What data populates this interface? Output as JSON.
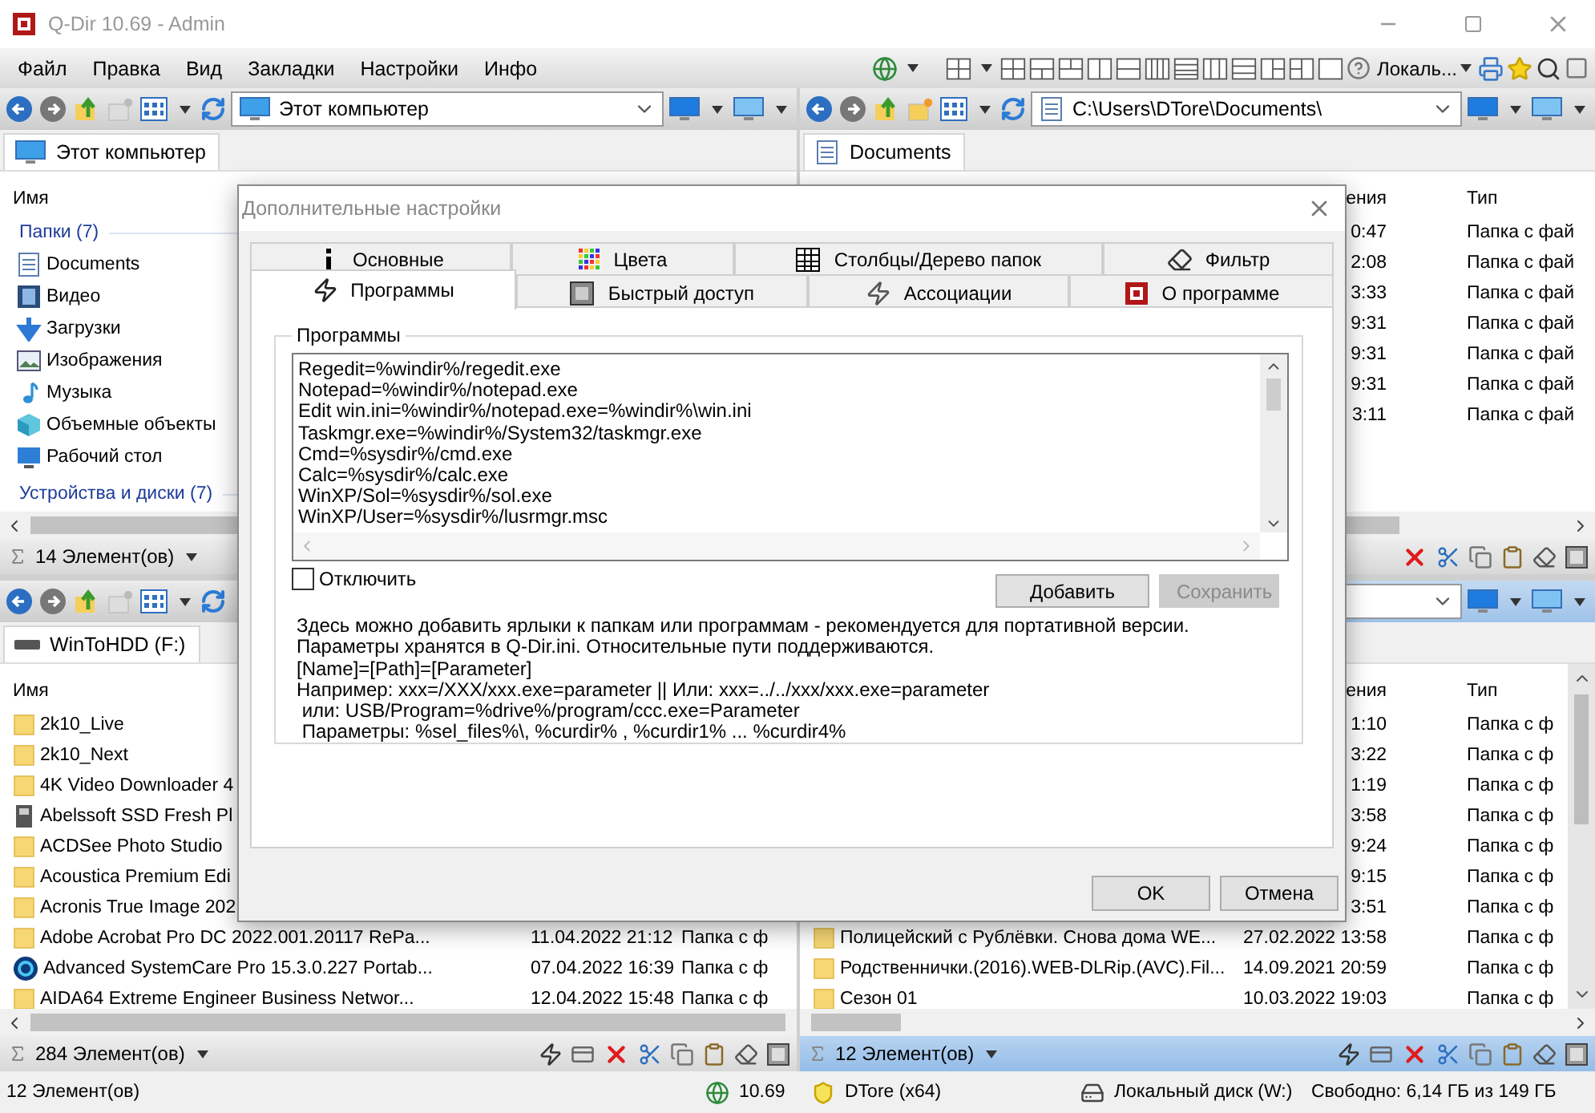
{
  "window": {
    "title": "Q-Dir 10.69 - Admin"
  },
  "menu": [
    "Файл",
    "Правка",
    "Вид",
    "Закладки",
    "Настройки",
    "Инфо"
  ],
  "toolbar": {
    "language": "Локаль..."
  },
  "panes": [
    {
      "active": false,
      "address": "Этот компьютер",
      "tab": "Этот компьютер",
      "columns": [
        {
          "kind": "name",
          "label": "Имя"
        }
      ],
      "groups": [
        {
          "label": "Папки (7)",
          "items": [
            "Documents",
            "Видео",
            "Загрузки",
            "Изображения",
            "Музыка",
            "Объемные объекты",
            "Рабочий стол"
          ]
        },
        {
          "label": "Устройства и диски (7)"
        }
      ],
      "count": "14 Элемент(ов)"
    },
    {
      "active": false,
      "address": "C:\\Users\\DTore\\Documents\\",
      "tab": "Documents",
      "columns": [
        {
          "kind": "date",
          "label": "ения"
        },
        {
          "kind": "type",
          "label": "Тип"
        }
      ],
      "rows": [
        {
          "date": "0:47",
          "type": "Папка с фай"
        },
        {
          "date": "2:08",
          "type": "Папка с фай"
        },
        {
          "date": "3:33",
          "type": "Папка с фай"
        },
        {
          "date": "9:31",
          "type": "Папка с фай"
        },
        {
          "date": "9:31",
          "type": "Папка с фай"
        },
        {
          "date": "9:31",
          "type": "Папка с фай"
        },
        {
          "date": "3:11",
          "type": "Папка с фай"
        }
      ]
    },
    {
      "active": false,
      "tab": "WinToHDD (F:)",
      "columns": [
        {
          "kind": "name",
          "label": "Имя"
        }
      ],
      "rows": [
        {
          "kind": "folder",
          "name": "2k10_Live"
        },
        {
          "kind": "folder",
          "name": "2k10_Next"
        },
        {
          "kind": "folder",
          "name": "4K Video Downloader 4"
        },
        {
          "kind": "device",
          "name": "Abelssoft SSD Fresh Pl"
        },
        {
          "kind": "folder",
          "name": "ACDSee Photo Studio"
        },
        {
          "kind": "folder",
          "name": "Acoustica Premium Edi"
        },
        {
          "kind": "folder",
          "name": "Acronis True Image 202"
        },
        {
          "kind": "folder",
          "name": "Adobe Acrobat Pro DC 2022.001.20117 RePa...",
          "date": "11.04.2022 21:12",
          "type": "Папка с ф"
        },
        {
          "kind": "app",
          "name": "Advanced SystemCare Pro 15.3.0.227 Portab...",
          "date": "07.04.2022 16:39",
          "type": "Папка с ф"
        },
        {
          "kind": "folder",
          "name": "AIDA64 Extreme  Engineer  Business  Networ...",
          "date": "12.04.2022 15:48",
          "type": "Папка с ф"
        }
      ],
      "count": "284 Элемент(ов)"
    },
    {
      "active": true,
      "columns": [
        {
          "kind": "date",
          "label": "ения"
        },
        {
          "kind": "type",
          "label": "Тип"
        }
      ],
      "rows": [
        {
          "date": "1:10",
          "type": "Папка с ф"
        },
        {
          "date": "3:22",
          "type": "Папка с ф"
        },
        {
          "date": "1:19",
          "type": "Папка с ф"
        },
        {
          "date": "3:58",
          "type": "Папка с ф"
        },
        {
          "date": "9:24",
          "type": "Папка с ф"
        },
        {
          "date": "9:15",
          "type": "Папка с ф"
        },
        {
          "date": "3:51",
          "type": "Папка с ф"
        },
        {
          "kind": "folder",
          "name": "Полицейский с Рублёвки. Снова дома WE...",
          "date": "27.02.2022 13:58",
          "type": "Папка с ф"
        },
        {
          "kind": "folder",
          "name": "Родственнички.(2016).WEB-DLRip.(AVC).Fil...",
          "date": "14.09.2021 20:59",
          "type": "Папка с ф"
        },
        {
          "kind": "folder",
          "name": "Сезон 01",
          "date": "10.03.2022 19:03",
          "type": "Папка с ф"
        }
      ],
      "count": "12 Элемент(ов)"
    }
  ],
  "status_bar": {
    "count": "12 Элемент(ов)",
    "version": "10.69",
    "user": "DTore (x64)",
    "drive": "Локальный диск (W:)",
    "free": "Свободно: 6,14 ГБ из 149 ГБ"
  },
  "dialog": {
    "title": "Дополнительные настройки",
    "tab_rows": [
      {
        "tabs": [
          {
            "label": "Основные",
            "selected": false
          },
          {
            "label": "Цвета",
            "selected": false
          },
          {
            "label": "Столбцы/Дерево папок",
            "selected": false
          },
          {
            "label": "Фильтр",
            "selected": false
          }
        ]
      },
      {
        "tabs": [
          {
            "label": "Программы",
            "selected": true
          },
          {
            "label": "Быстрый доступ",
            "selected": false
          },
          {
            "label": "Ассоциации",
            "selected": false
          },
          {
            "label": "О программе",
            "selected": false
          }
        ]
      }
    ],
    "group_label": "Программы",
    "program_lines": [
      "Regedit=%windir%/regedit.exe",
      "Notepad=%windir%/notepad.exe",
      "Edit win.ini=%windir%/notepad.exe=%windir%\\win.ini",
      "Taskmgr.exe=%windir%/System32/taskmgr.exe",
      "Cmd=%sysdir%/cmd.exe",
      "Calc=%sysdir%/calc.exe",
      "WinXP/Sol=%sysdir%/sol.exe",
      "WinXP/User=%sysdir%/lusrmgr.msc"
    ],
    "disable": {
      "label": "Отключить",
      "checked": false
    },
    "buttons": [
      {
        "label": "Добавить",
        "disabled": false
      },
      {
        "label": "Сохранить",
        "disabled": true
      }
    ],
    "help": [
      "Здесь можно добавить ярлыки к папкам или программам - рекомендуется для портативной версии. Параметры хранятся в Q-Dir.ini. Относительные пути поддерживаются.",
      "[Name]=[Path]=[Parameter]",
      "Например: xxx=/XXX/xxx.exe=parameter || Или: xxx=../../xxx/xxx.exe=parameter",
      " или: USB/Program=%drive%/program/ccc.exe=Parameter",
      " Параметры: %sel_files%\\, %curdir% , %curdir1% ... %curdir4%"
    ],
    "footer_buttons": [
      "OK",
      "Отмена"
    ]
  }
}
